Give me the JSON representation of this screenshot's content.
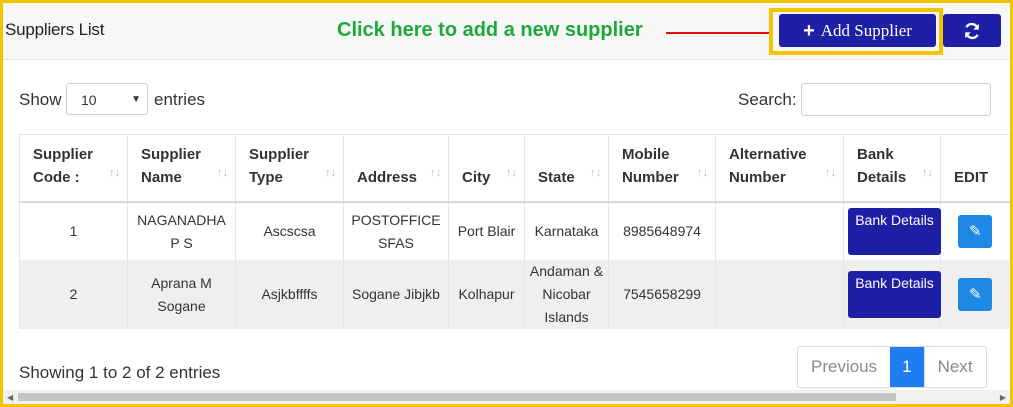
{
  "header": {
    "title": "Suppliers List",
    "callout": "Click here to add a new supplier",
    "add_button": "Add Supplier",
    "add_icon": "plus-icon",
    "refresh_icon": "refresh-icon"
  },
  "controls": {
    "show_label": "Show",
    "page_size": "10",
    "entries_label": "entries",
    "search_label": "Search:",
    "search_value": ""
  },
  "table": {
    "columns": [
      "Supplier Code :",
      "Supplier Name",
      "Supplier Type",
      "Address",
      "City",
      "State",
      "Mobile Number",
      "Alternative Number",
      "Bank Details",
      "EDIT"
    ],
    "rows": [
      {
        "code": "1",
        "name": "NAGANADHA P S",
        "type": "Ascscsa",
        "address": "POSTOFFICE SFAS",
        "city": "Port Blair",
        "state": "Karnataka",
        "mobile": "8985648974",
        "alternative": "",
        "bank_button": "Bank Details"
      },
      {
        "code": "2",
        "name": "Aprana M Sogane",
        "type": "Asjkbffffs",
        "address": "Sogane Jibjkb",
        "city": "Kolhapur",
        "state": "Andaman & Nicobar Islands",
        "mobile": "7545658299",
        "alternative": "",
        "bank_button": "Bank Details"
      }
    ]
  },
  "footer": {
    "showing": "Showing 1 to 2 of 2 entries",
    "previous": "Previous",
    "current_page": "1",
    "next": "Next"
  },
  "colors": {
    "primary": "#1f1fa6",
    "edit": "#1e88e5",
    "highlight": "#f5c400",
    "callout": "#1fa83a",
    "arrow": "#e01010"
  }
}
